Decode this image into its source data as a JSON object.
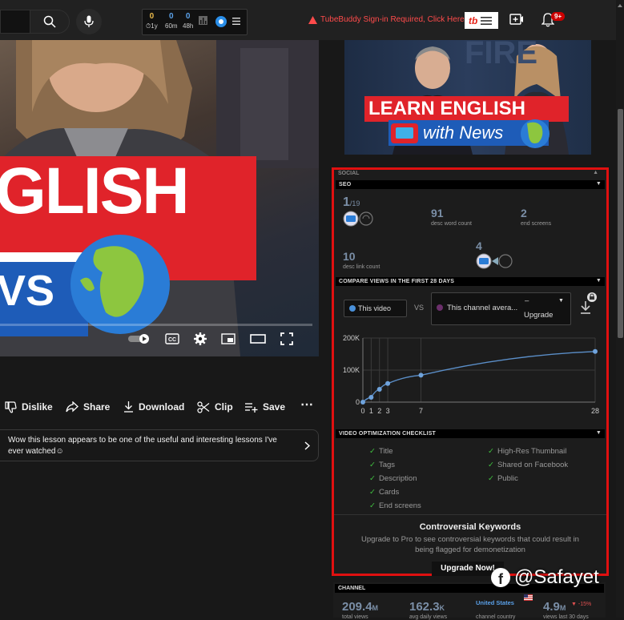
{
  "topbar": {
    "stats": [
      {
        "value": "0",
        "label": "1y",
        "color": "#e8b84a"
      },
      {
        "value": "0",
        "label": "60m",
        "color": "#5aa0e8"
      },
      {
        "value": "0",
        "label": "48h",
        "color": "#5aa0e8"
      }
    ],
    "tubebuddy_warning": "TubeBuddy Sign-in Required, Click Here",
    "tb_logo": "tb",
    "notification_count": "9+"
  },
  "video": {
    "overlay_text_1": "GLISH",
    "overlay_text_2": "VS"
  },
  "actions": {
    "dislike": "Dislike",
    "share": "Share",
    "download": "Download",
    "clip": "Clip",
    "save": "Save"
  },
  "comment": {
    "text": "Wow this lesson appears to be one of the useful and interesting lessons I've ever watched☺"
  },
  "thumbnail": {
    "line1": "LEARN ENGLISH",
    "line2": "with News",
    "bg_text": "FIRE"
  },
  "panel": {
    "social_header": "SOCIAL",
    "seo_header": "SEO",
    "seo": {
      "rank_main": "1",
      "rank_total": "/19",
      "desc_word_count": "91",
      "desc_word_count_label": "desc word count",
      "end_screens": "2",
      "end_screens_label": "end screens",
      "desc_link_count": "10",
      "desc_link_count_label": "desc link count",
      "cards": "4"
    },
    "compare_header": "COMPARE VIEWS IN THE FIRST 28 DAYS",
    "compare": {
      "this_video_label": "This video",
      "vs_label": "VS",
      "channel_avg_label": "This channel avera...",
      "upgrade_label": "Upgrade",
      "dash": "–"
    },
    "checklist_header": "VIDEO OPTIMIZATION CHECKLIST",
    "checklist_left": [
      "Title",
      "Tags",
      "Description",
      "Cards",
      "End screens"
    ],
    "checklist_right": [
      "High-Res Thumbnail",
      "Shared on Facebook",
      "Public"
    ],
    "keywords": {
      "title": "Controversial Keywords",
      "body": "Upgrade to Pro to see controversial keywords that could result in being flagged for demonetization",
      "button": "Upgrade Now!"
    }
  },
  "channel": {
    "header": "CHANNEL",
    "total_views": "209.4",
    "total_views_suffix": "M",
    "total_views_label": "total views",
    "avg_daily": "162.3",
    "avg_daily_suffix": "K",
    "avg_daily_label": "avg daily views",
    "country": "United States",
    "country_label": "channel country",
    "last30": "4.9",
    "last30_suffix": "M",
    "last30_change": "▼ -15%",
    "last30_label": "views last 30 days"
  },
  "watermark": "@Safayet",
  "chart_data": {
    "type": "line",
    "x": [
      0,
      1,
      2,
      3,
      7,
      28
    ],
    "series": [
      {
        "values": [
          0,
          15000,
          40000,
          58000,
          84000,
          158000
        ]
      }
    ],
    "xticks": [
      "0",
      "1",
      "2",
      "3",
      "7",
      "28"
    ],
    "yticks": [
      "0",
      "100K",
      "200K"
    ],
    "ylim": [
      0,
      200000
    ],
    "xlim": [
      0,
      28
    ],
    "grid": true
  }
}
